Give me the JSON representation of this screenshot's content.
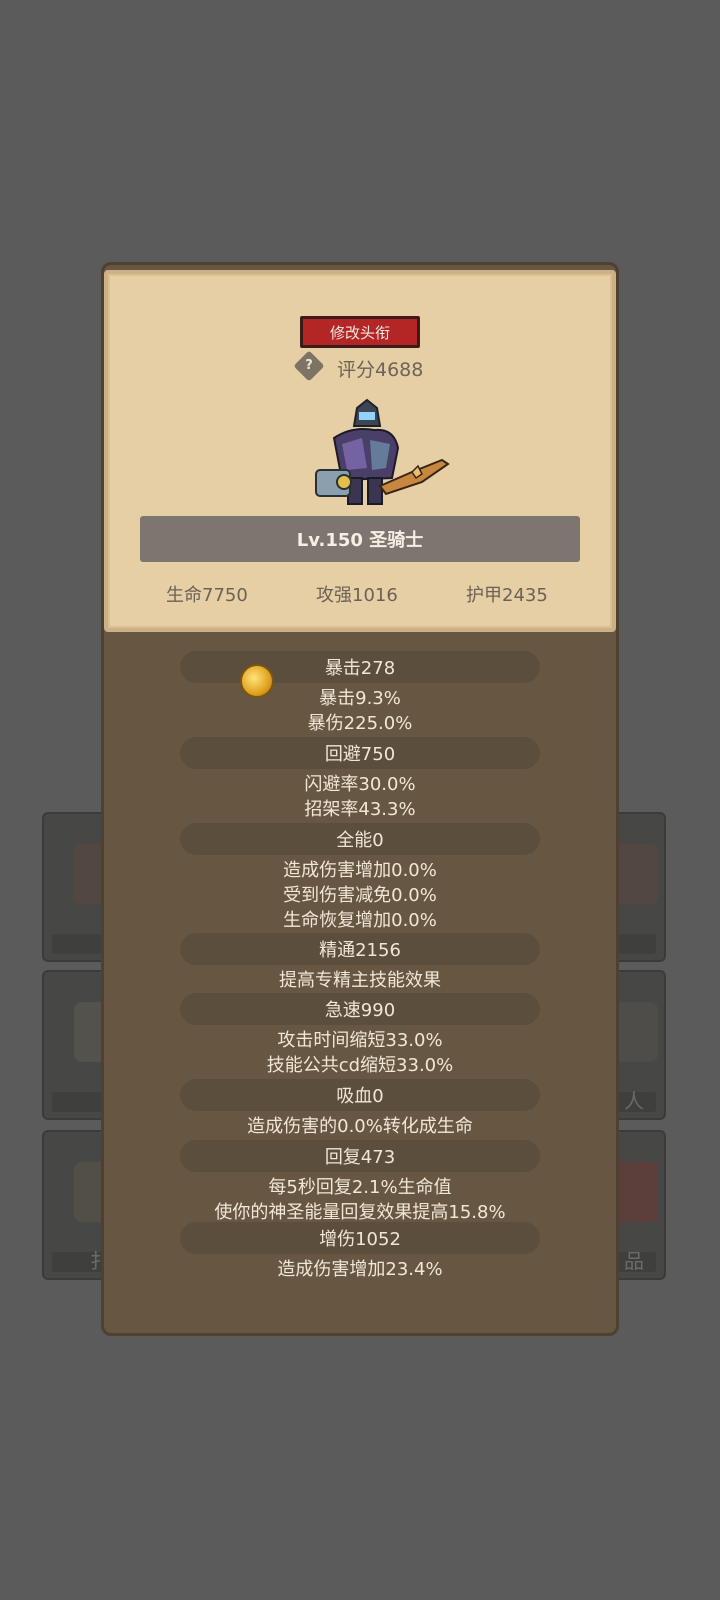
{
  "card": {
    "title_button": "修改头衔",
    "help_glyph": "?",
    "score": "评分4688",
    "name": "Lv.150 圣骑士",
    "stats": [
      "生命7750",
      "攻强1016",
      "护甲2435"
    ]
  },
  "background": {
    "slot_labels": [
      "扌",
      "人",
      "品"
    ]
  },
  "attributes": [
    {
      "label": "暴击278",
      "lines": [
        "暴击9.3%",
        "暴伤225.0%"
      ]
    },
    {
      "label": "回避750",
      "lines": [
        "闪避率30.0%",
        "招架率43.3%"
      ]
    },
    {
      "label": "全能0",
      "lines": [
        "造成伤害增加0.0%",
        "受到伤害减免0.0%",
        "生命恢复增加0.0%"
      ]
    },
    {
      "label": "精通2156",
      "lines": [
        "提高专精主技能效果"
      ]
    },
    {
      "label": "急速990",
      "lines": [
        "攻击时间缩短33.0%",
        "技能公共cd缩短33.0%"
      ]
    },
    {
      "label": "吸血0",
      "lines": [
        "造成伤害的0.0%转化成生命"
      ]
    },
    {
      "label": "回复473",
      "lines": [
        "每5秒回复2.1%生命值",
        "使你的神圣能量回复效果提高15.8%"
      ]
    },
    {
      "label": "增伤1052",
      "lines": [
        "造成伤害增加23.4%"
      ]
    }
  ],
  "icons": {
    "hero": "paladin-hero-sprite",
    "coin": "gold-coin-icon",
    "help": "help-diamond-icon"
  }
}
